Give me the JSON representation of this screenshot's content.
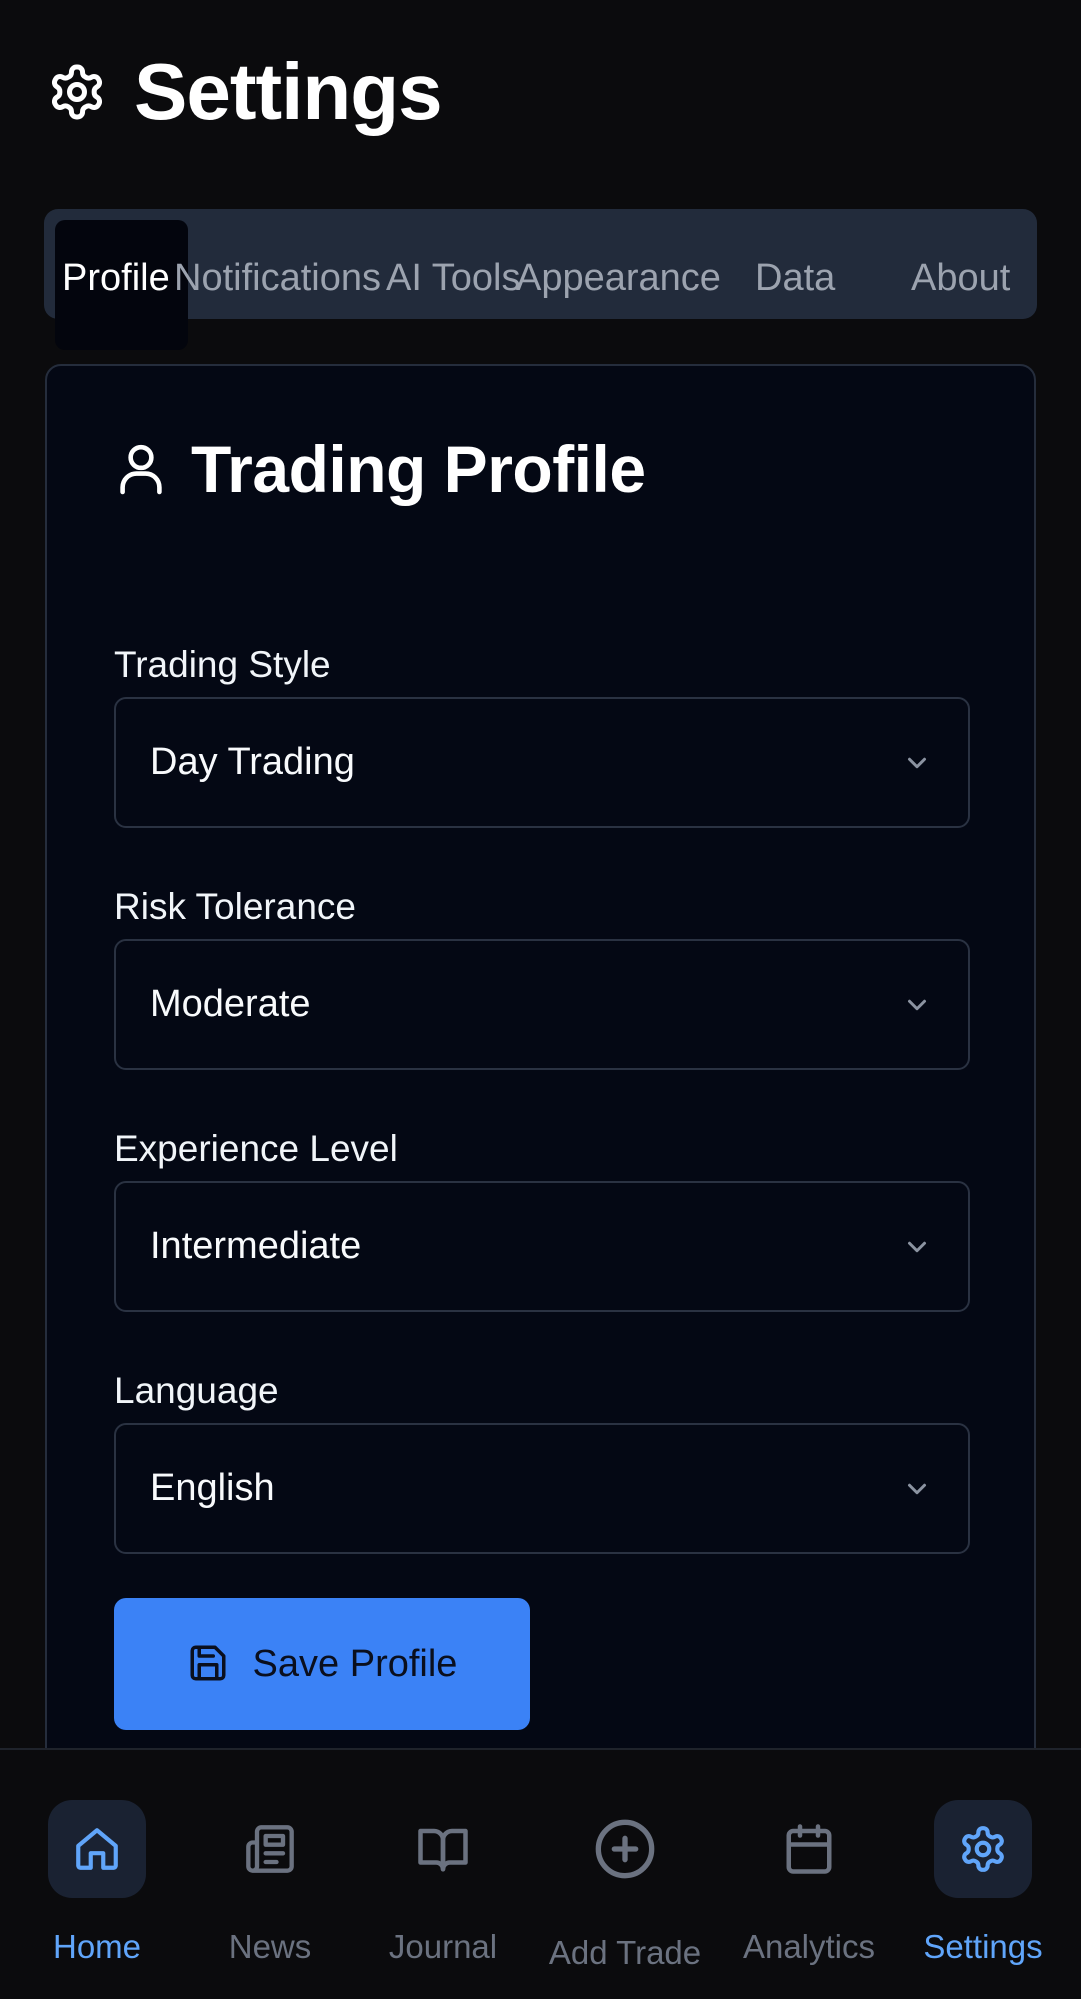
{
  "header": {
    "title": "Settings",
    "icon": "gear-icon"
  },
  "tabs": [
    {
      "label": "Profile",
      "active": true
    },
    {
      "label": "Notifications",
      "active": false
    },
    {
      "label": "AI Tools",
      "active": false
    },
    {
      "label": "Appearance",
      "active": false
    },
    {
      "label": "Data",
      "active": false
    },
    {
      "label": "About",
      "active": false
    }
  ],
  "profile": {
    "title": "Trading Profile",
    "icon": "user-icon",
    "fields": [
      {
        "label": "Trading Style",
        "value": "Day Trading"
      },
      {
        "label": "Risk Tolerance",
        "value": "Moderate"
      },
      {
        "label": "Experience Level",
        "value": "Intermediate"
      },
      {
        "label": "Language",
        "value": "English"
      }
    ],
    "save_label": "Save Profile"
  },
  "bottom_nav": [
    {
      "label": "Home",
      "icon": "home-icon"
    },
    {
      "label": "News",
      "icon": "newspaper-icon"
    },
    {
      "label": "Journal",
      "icon": "book-open-icon"
    },
    {
      "label": "Add Trade",
      "icon": "plus-circle-icon"
    },
    {
      "label": "Analytics",
      "icon": "calendar-icon"
    },
    {
      "label": "Settings",
      "icon": "gear-icon"
    }
  ],
  "colors": {
    "accent": "#3b82f6",
    "active_nav": "#60a5fa",
    "background": "#0b0b0d",
    "card": "#040814",
    "tab_bar": "#222b3b"
  }
}
